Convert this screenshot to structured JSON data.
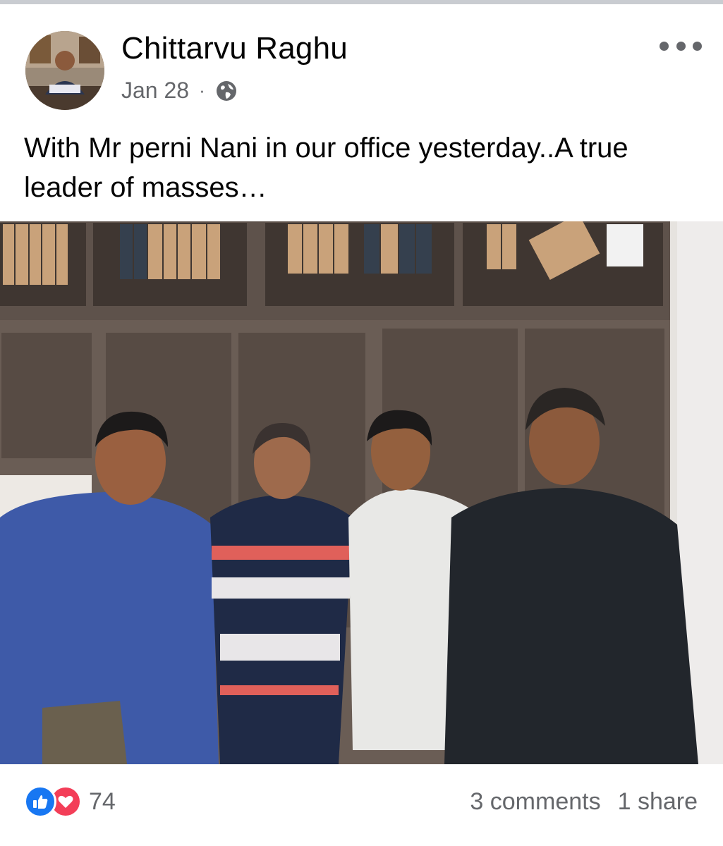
{
  "post": {
    "author": "Chittarvu Raghu",
    "date": "Jan 28",
    "separator": "·",
    "privacy_icon": "globe-icon",
    "more_icon": "more-options-icon",
    "caption": "With Mr perni Nani in our office yesterday..A true leader of masses…"
  },
  "footer": {
    "reaction_icons": [
      "like-icon",
      "love-icon"
    ],
    "reaction_count": "74",
    "comments": "3 comments",
    "shares": "1 share"
  },
  "colors": {
    "like": "#1877f2",
    "love": "#f33e58",
    "meta_text": "#65676b"
  }
}
